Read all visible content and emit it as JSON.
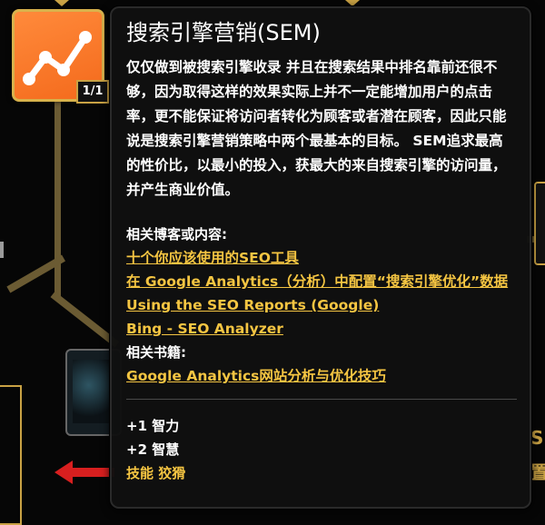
{
  "skill": {
    "icon": "analytics-chart-icon",
    "count": "1/1",
    "accent_color": "#f46a1c"
  },
  "tooltip": {
    "title": "搜索引擎营销(SEM)",
    "description": "仅仅做到被搜索引擎收录 并且在搜索结果中排名靠前还很不够，因为取得这样的效果实际上并不一定能增加用户的点击率，更不能保证将访问者转化为顾客或者潜在顾客，因此只能说是搜索引擎营销策略中两个最基本的目标。 SEM追求最高的性价比，以最小的投入，获最大的来自搜索引擎的访问量，并产生商业价值。",
    "related_label": "相关博客或内容:",
    "related_links": [
      "十个你应该使用的SEO工具",
      "在 Google Analytics（分析）中配置“搜索引擎优化”数据",
      "Using the SEO Reports (Google)",
      "Bing - SEO Analyzer"
    ],
    "books_label": "相关书籍:",
    "books": [
      "Google Analytics网站分析与优化技巧"
    ],
    "stats": [
      "+1 智力",
      "+2 智慧"
    ],
    "skill_tag": "技能 狡猾",
    "link_color": "#f5c542"
  },
  "background": {
    "right_chars": [
      "S",
      "置"
    ]
  }
}
